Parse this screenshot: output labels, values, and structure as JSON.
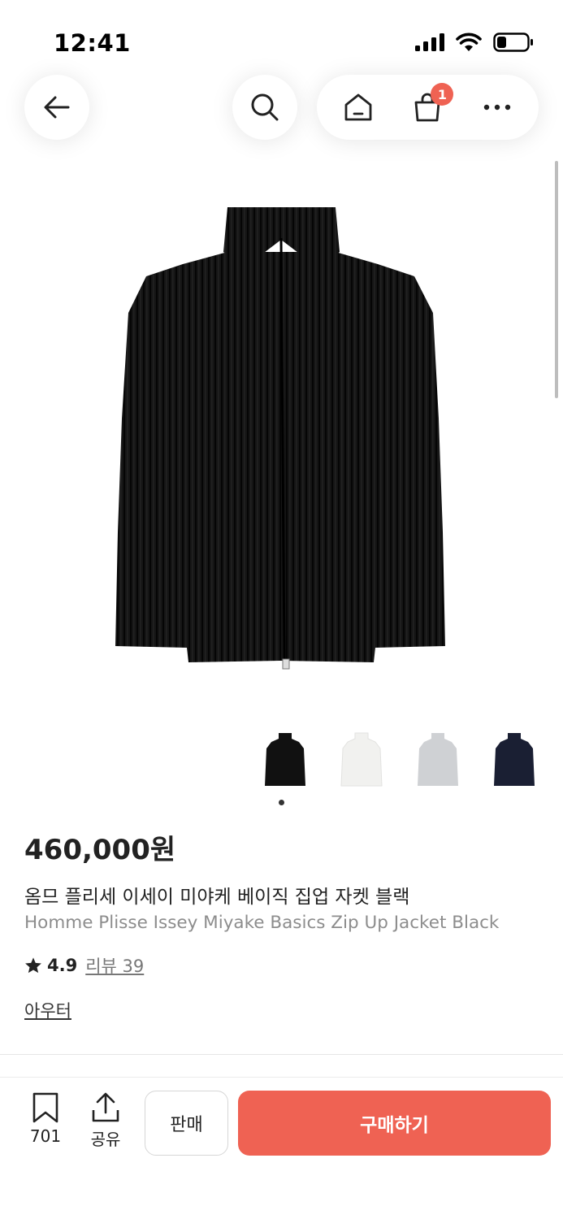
{
  "status_bar": {
    "time": "12:41"
  },
  "nav": {
    "back_icon": "arrow-left-icon",
    "search_icon": "search-icon",
    "home_icon": "home-icon",
    "cart_icon": "shopping-bag-icon",
    "cart_count": "1",
    "more_icon": "more-horizontal-icon"
  },
  "product": {
    "image": "black-pleated-zip-jacket",
    "thumbnails": [
      {
        "color": "#111111",
        "name": "black"
      },
      {
        "color": "#f1f1ef",
        "name": "white"
      },
      {
        "color": "#cfd1d4",
        "name": "light-grey"
      },
      {
        "color": "#1a1f33",
        "name": "navy"
      }
    ],
    "price": "460,000원",
    "title_ko": "옴므 플리세 이세이 미야케 베이직 집업 자켓 블랙",
    "title_en": "Homme Plisse Issey Miyake Basics Zip Up Jacket Black",
    "rating": "4.9",
    "review_label": "리뷰 39",
    "category": "아우터"
  },
  "bottom_bar": {
    "bookmark_count": "701",
    "share_label": "공유",
    "sell_label": "판매",
    "buy_label": "구매하기"
  },
  "colors": {
    "accent": "#ef6253"
  }
}
